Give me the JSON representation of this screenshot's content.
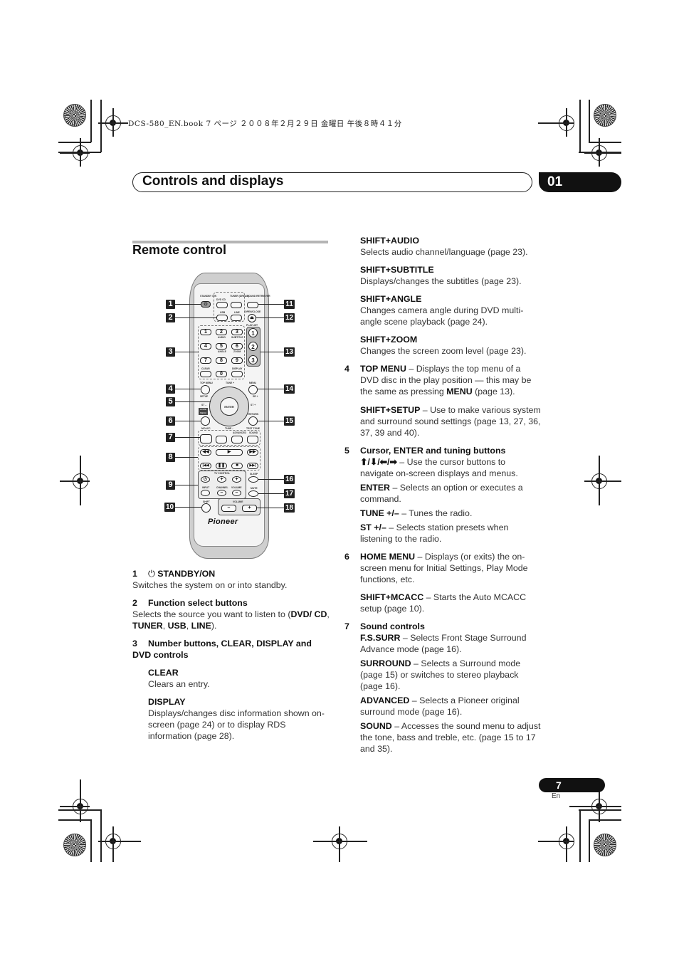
{
  "print_header": {
    "text": "DCS-580_EN.book  7 ページ  ２００８年２月２９日  金曜日  午後８時４１分"
  },
  "chapter": {
    "title": "Controls and displays",
    "number": "01"
  },
  "section": {
    "title": "Remote control"
  },
  "remote": {
    "brand": "Pioneer",
    "callouts_left": [
      "1",
      "2",
      "3",
      "4",
      "5",
      "6",
      "7",
      "8",
      "9",
      "10"
    ],
    "callouts_right": [
      "11",
      "12",
      "13",
      "14",
      "15",
      "16",
      "17",
      "18"
    ],
    "labels": {
      "standby": "STANDBY /ON",
      "dvdcd": "DVD CD",
      "tuner": "TUNER (DREAM)",
      "sound_retriever": "SOUND RETRIEVER",
      "usb": "USB",
      "line": "LINE",
      "open_close": "OPEN/CLOSE",
      "playlist": "PLAYLIST",
      "audio": "AUDIO",
      "subtitle": "SUBTITLE",
      "angle": "ANGLE",
      "zoom": "ZOOM",
      "clear": "CLEAR",
      "display": "DISPLAY",
      "top_menu": "TOP MENU",
      "menu": "MENU",
      "setup": "SETUP",
      "sr": "SR +",
      "tune_plus": "TUNE +",
      "tune_minus": "TUNE –",
      "st_minus": "ST –",
      "st_plus": "ST +",
      "enter": "ENTER",
      "home_menu": "HOME MENU",
      "mcacc": "MCACC",
      "return": "RETURN",
      "test_tone": "TEST TONE",
      "advanced": "ADVANCED",
      "sound": "SOUND",
      "tv_control": "TV CONTROL",
      "input": "INPUT",
      "channel": "CHANNEL",
      "volume": "VOLUME",
      "sleep": "SLEEP",
      "mute": "MUTE",
      "shift": "SHIFT",
      "volume_main": "VOLUME"
    },
    "keys": [
      "1",
      "2",
      "3",
      "4",
      "5",
      "6",
      "7",
      "8",
      "9",
      "0"
    ],
    "playlist_keys": [
      "1",
      "2",
      "3"
    ]
  },
  "left_column": {
    "items": [
      {
        "num": "1",
        "icon": "power-icon",
        "title": "STANDBY/ON",
        "body": "Switches the system on or into standby."
      },
      {
        "num": "2",
        "title": "Function select buttons",
        "body_pre": "Selects the source you want to listen to (",
        "body_bold": [
          "DVD/ CD",
          "TUNER",
          "USB",
          "LINE"
        ],
        "body_post": ")."
      },
      {
        "num": "3",
        "title": "Number buttons, CLEAR, DISPLAY and DVD controls"
      }
    ],
    "sub_items": [
      {
        "title": "CLEAR",
        "body": "Clears an entry."
      },
      {
        "title": "DISPLAY",
        "body": "Displays/changes disc information shown on-screen (page 24) or to display RDS information (page 28)."
      }
    ]
  },
  "right_column": {
    "shift_items": [
      {
        "title": "SHIFT+AUDIO",
        "body": "Selects audio channel/language (page 23)."
      },
      {
        "title": "SHIFT+SUBTITLE",
        "body": "Displays/changes the subtitles (page 23)."
      },
      {
        "title": "SHIFT+ANGLE",
        "body": "Changes camera angle during DVD multi-angle scene playback (page 24)."
      },
      {
        "title": "SHIFT+ZOOM",
        "body": "Changes the screen zoom level (page 23)."
      }
    ],
    "item4": {
      "num": "4",
      "title": "TOP MENU",
      "body_a": " – Displays the top menu of a DVD disc in the play position — this may be the same as pressing ",
      "body_bold": "MENU",
      "body_b": " (page 13).",
      "sub_title": "SHIFT+SETUP",
      "sub_body": " – Use to make various system and surround sound settings (page 13, 27, 36, 37, 39 and 40)."
    },
    "item5": {
      "num": "5",
      "title": "Cursor, ENTER and tuning buttons",
      "arrows": "⬆/⬇/⬅/➡",
      "arrows_body": " – Use the cursor buttons to navigate on-screen displays and menus.",
      "enter_title": "ENTER",
      "enter_body": " – Selects an option or executes a command.",
      "tune_title": "TUNE +/–",
      "tune_body": " – Tunes the radio.",
      "st_title": "ST +/–",
      "st_body": " – Selects station presets when listening to the radio."
    },
    "item6": {
      "num": "6",
      "title": "HOME MENU",
      "body": " – Displays (or exits) the on-screen menu for Initial Settings, Play Mode functions, etc.",
      "sub_title": "SHIFT+MCACC",
      "sub_body": " – Starts the Auto MCACC setup (page 10)."
    },
    "item7": {
      "num": "7",
      "title": "Sound controls",
      "subs": [
        {
          "title": "F.S.SURR",
          "body": " – Selects Front Stage Surround Advance mode (page 16)."
        },
        {
          "title": "SURROUND",
          "body": " – Selects a Surround mode (page 15) or switches to stereo playback (page 16)."
        },
        {
          "title": "ADVANCED",
          "body": " – Selects a Pioneer original surround mode (page 16)."
        },
        {
          "title": "SOUND",
          "body": " – Accesses the sound menu to adjust the tone, bass and treble, etc. (page 15 to 17 and 35)."
        }
      ]
    }
  },
  "footer": {
    "page_number": "7",
    "language": "En"
  }
}
